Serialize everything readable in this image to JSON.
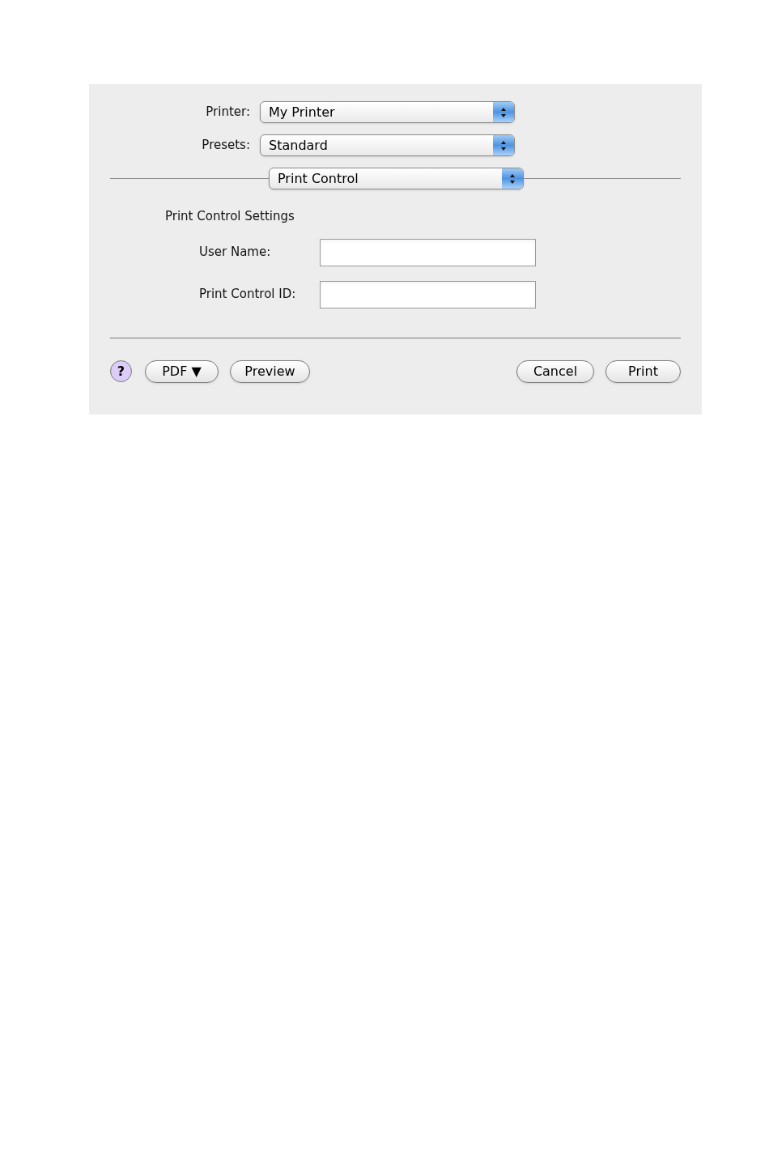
{
  "popups": [
    {
      "label": "Printer:",
      "value": "My Printer"
    },
    {
      "label": "Presets:",
      "value": "Standard"
    }
  ],
  "pane_popup": {
    "value": "Print Control"
  },
  "section_title": "Print Control Settings",
  "fields": [
    {
      "label": "User Name:"
    },
    {
      "label": "Print Control ID:"
    }
  ],
  "help_button": "?",
  "left_buttons": [
    "PDF ▼",
    "Preview"
  ],
  "right_buttons": [
    "Cancel",
    "Print"
  ]
}
